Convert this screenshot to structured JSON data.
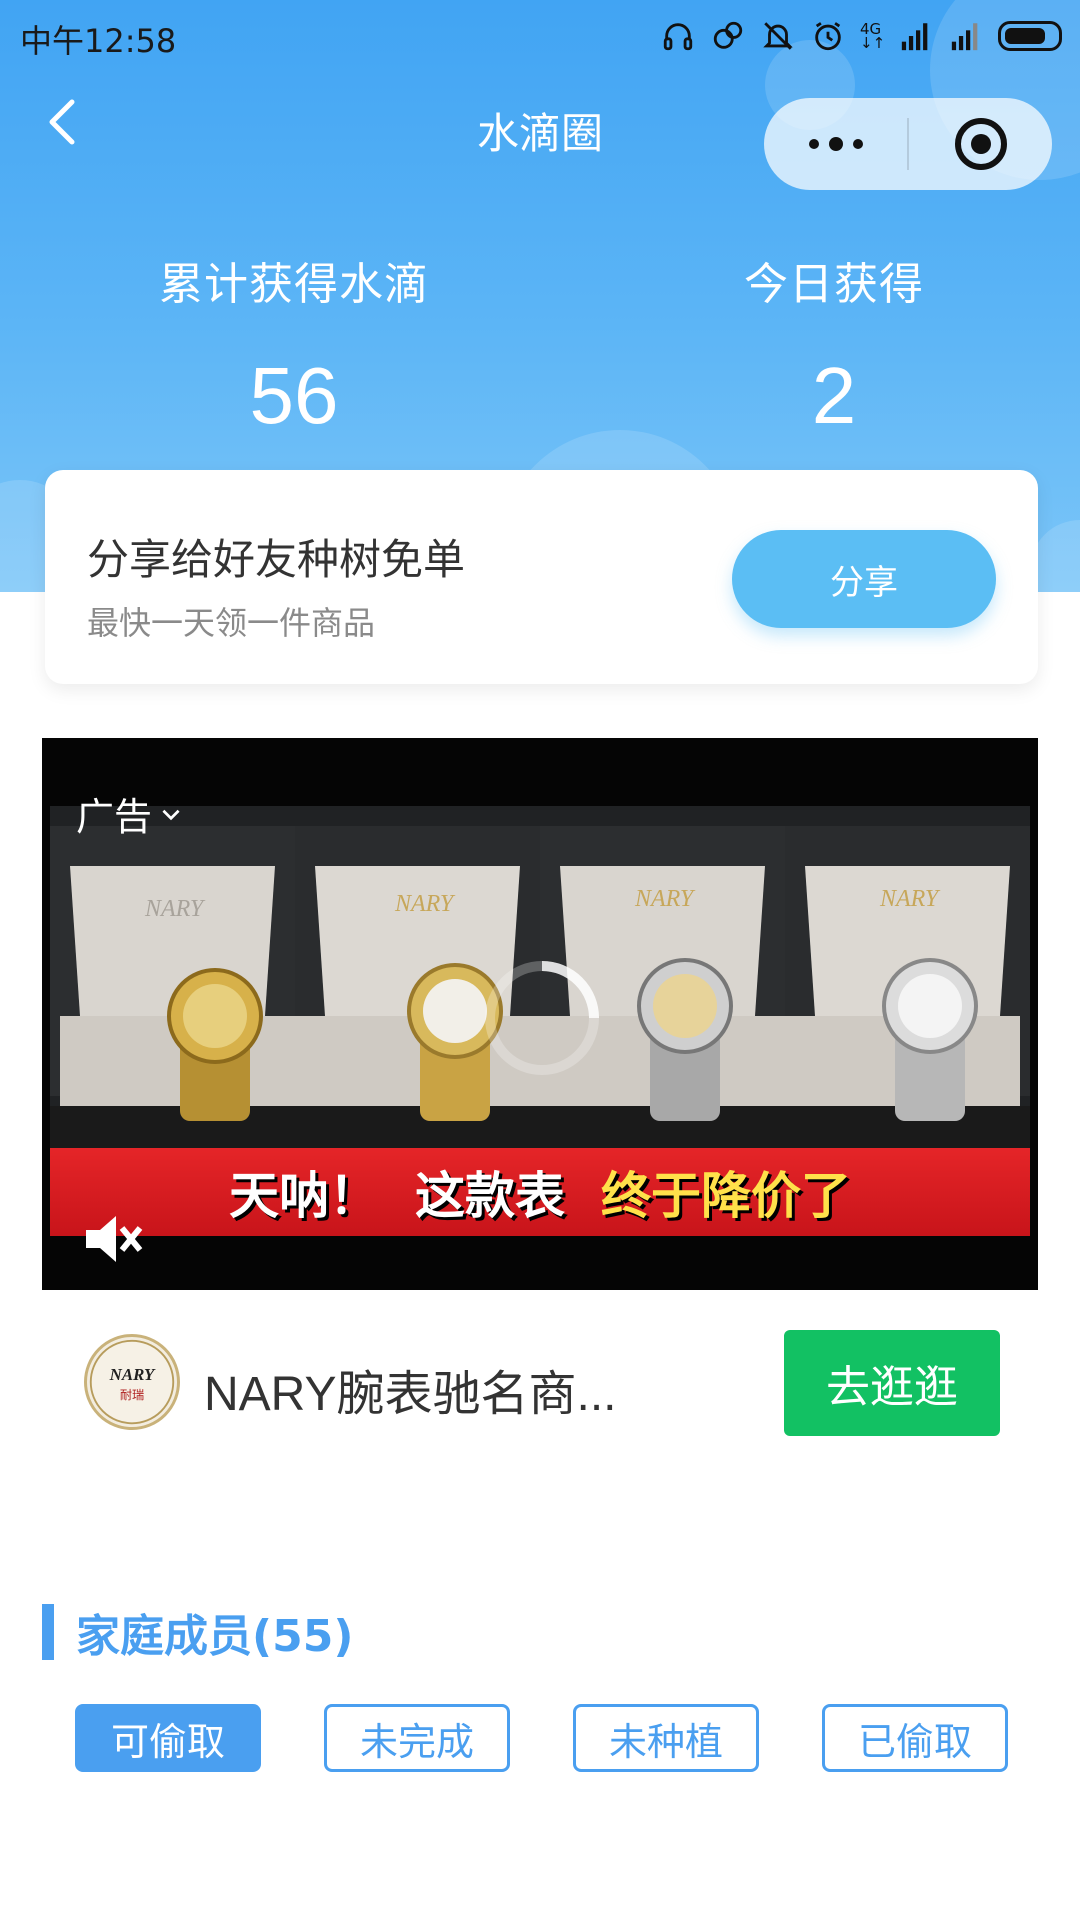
{
  "status_bar": {
    "time": "中午12:58",
    "network_label_top": "4G",
    "network_label_bottom": "↓↑"
  },
  "nav": {
    "title": "水滴圈"
  },
  "stats": {
    "total_label": "累计获得水滴",
    "total_value": "56",
    "today_label": "今日获得",
    "today_value": "2"
  },
  "share_card": {
    "title": "分享给好友种树免单",
    "subtitle": "最快一天领一件商品",
    "button_label": "分享"
  },
  "ad": {
    "tag": "广告",
    "caption_part1": "天呐！",
    "caption_part2": "这款表",
    "caption_part3": "终于降价了",
    "brand_on_box": "NARY",
    "advertiser_name": "NARY腕表驰名商...",
    "cta_label": "去逛逛",
    "logo_text": "NARY",
    "logo_subtext": "耐瑞"
  },
  "family": {
    "title": "家庭成员(55)",
    "tabs": [
      {
        "label": "可偷取",
        "active": true
      },
      {
        "label": "未完成",
        "active": false
      },
      {
        "label": "未种植",
        "active": false
      },
      {
        "label": "已偷取",
        "active": false
      }
    ]
  },
  "colors": {
    "header_blue": "#41a4f3",
    "accent_blue": "#4a9ff0",
    "share_button": "#5bbef4",
    "cta_green": "#12c163",
    "caption_red": "#e52528"
  },
  "icons": {
    "back": "chevron-left-icon",
    "more": "more-dots-icon",
    "close": "target-circle-icon",
    "mute": "speaker-muted-icon",
    "ad_dropdown": "chevron-down-icon"
  }
}
